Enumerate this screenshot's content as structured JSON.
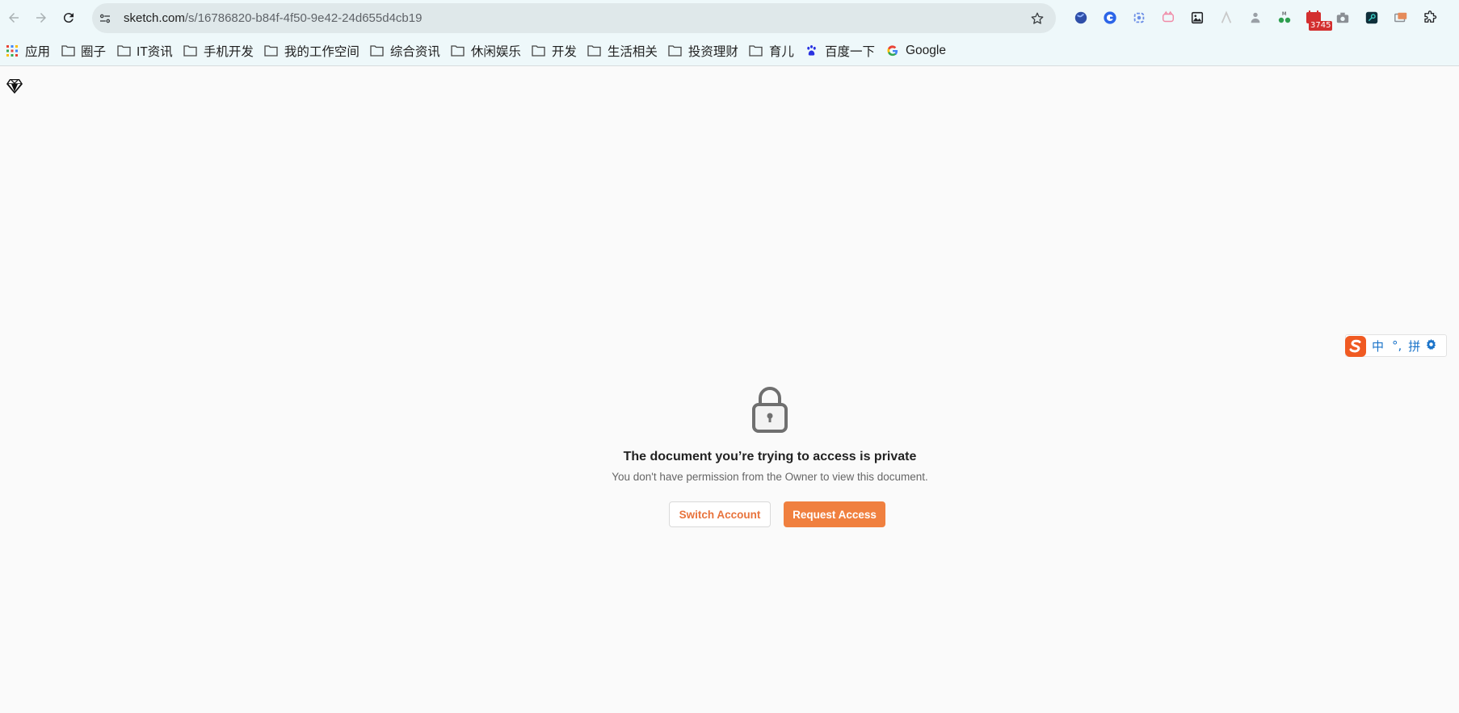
{
  "browser": {
    "url_host": "sketch.com",
    "url_path": "/s/16786820-b84f-4f50-9e42-24d655d4cb19",
    "extension_badge": "3745"
  },
  "bookmarks": [
    {
      "label": "应用",
      "icon": "apps-grid-icon"
    },
    {
      "label": "圈子",
      "icon": "folder-icon"
    },
    {
      "label": "IT资讯",
      "icon": "folder-icon"
    },
    {
      "label": "手机开发",
      "icon": "folder-icon"
    },
    {
      "label": "我的工作空间",
      "icon": "folder-icon"
    },
    {
      "label": "综合资讯",
      "icon": "folder-icon"
    },
    {
      "label": "休闲娱乐",
      "icon": "folder-icon"
    },
    {
      "label": "开发",
      "icon": "folder-icon"
    },
    {
      "label": "生活相关",
      "icon": "folder-icon"
    },
    {
      "label": "投资理财",
      "icon": "folder-icon"
    },
    {
      "label": "育儿",
      "icon": "folder-icon"
    },
    {
      "label": "百度一下",
      "icon": "baidu-paw-icon"
    },
    {
      "label": "Google",
      "icon": "google-g-icon"
    }
  ],
  "page": {
    "title": "The document you’re trying to access is private",
    "subtitle": "You don't have permission from the Owner to view this document.",
    "switch_account_label": "Switch Account",
    "request_access_label": "Request Access"
  },
  "ime": {
    "mode": "中",
    "punct": "°,",
    "pinyin": "拼"
  },
  "colors": {
    "accent": "#f0803f",
    "toolbar_bg": "#eef8fa",
    "page_bg": "#fafafa"
  }
}
